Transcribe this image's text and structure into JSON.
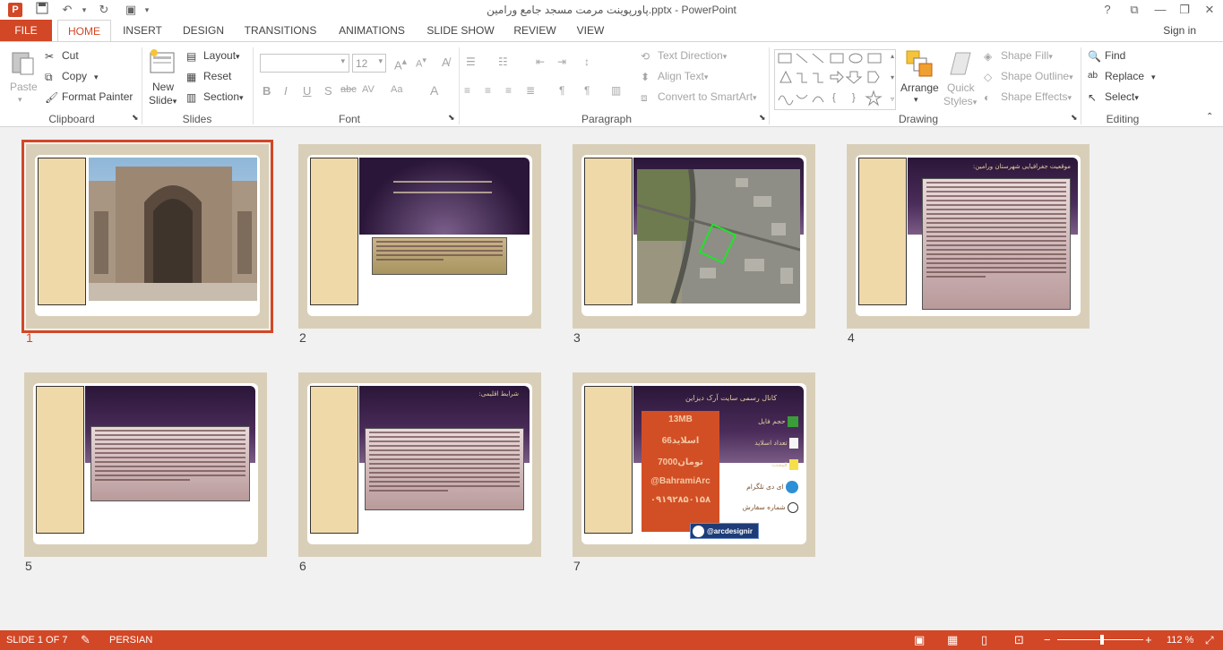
{
  "window": {
    "title": "پاورپوینت مرمت مسجد جامع ورامین.pptx - PowerPoint",
    "help": "?",
    "minimize": "—",
    "restore": "❐",
    "close": "✕"
  },
  "tabs": [
    {
      "label": "FILE"
    },
    {
      "label": "HOME"
    },
    {
      "label": "INSERT"
    },
    {
      "label": "DESIGN"
    },
    {
      "label": "TRANSITIONS"
    },
    {
      "label": "ANIMATIONS"
    },
    {
      "label": "SLIDE SHOW"
    },
    {
      "label": "REVIEW"
    },
    {
      "label": "VIEW"
    }
  ],
  "signin": "Sign in",
  "ribbon": {
    "clipboard": {
      "label": "Clipboard",
      "paste": "Paste",
      "cut": "Cut",
      "copy": "Copy",
      "format_painter": "Format Painter"
    },
    "slides": {
      "label": "Slides",
      "new_slide": "New",
      "new_slide2": "Slide",
      "layout": "Layout",
      "reset": "Reset",
      "section": "Section"
    },
    "font": {
      "label": "Font",
      "size": "12"
    },
    "paragraph": {
      "label": "Paragraph",
      "text_direction": "Text Direction",
      "align_text": "Align Text",
      "convert_smartart": "Convert to SmartArt"
    },
    "drawing": {
      "label": "Drawing",
      "arrange": "Arrange",
      "quick_styles": "Quick",
      "quick_styles2": "Styles",
      "shape_fill": "Shape Fill",
      "shape_outline": "Shape Outline",
      "shape_effects": "Shape Effects"
    },
    "editing": {
      "label": "Editing",
      "find": "Find",
      "replace": "Replace",
      "select": "Select"
    }
  },
  "slides": [
    {
      "num": "1"
    },
    {
      "num": "2"
    },
    {
      "num": "3"
    },
    {
      "num": "4",
      "heading": "موقعیت جغرافیایی شهرستان ورامین:"
    },
    {
      "num": "5"
    },
    {
      "num": "6",
      "heading": "شرایط اقلیمی:"
    },
    {
      "num": "7",
      "heading": "کانال رسمی سایت آرک دیزاین",
      "file_size": "13MB",
      "slide_count": "66اسلاید",
      "price": "7000تومان",
      "handle": "@BahramiArc",
      "phone": "۰۹۱۹۲۸۵۰۱۵۸",
      "row1": "حجم فایل",
      "row2": "تعداد اسلاید",
      "row3": "قیمت",
      "row4": "ای دی تلگرام",
      "row5": "شماره سفارش",
      "tg": "@arcdesignir"
    }
  ],
  "status": {
    "slide_of": "SLIDE 1 OF 7",
    "language": "PERSIAN",
    "zoom": "112 %"
  },
  "colors": {
    "accent": "#d24726"
  }
}
